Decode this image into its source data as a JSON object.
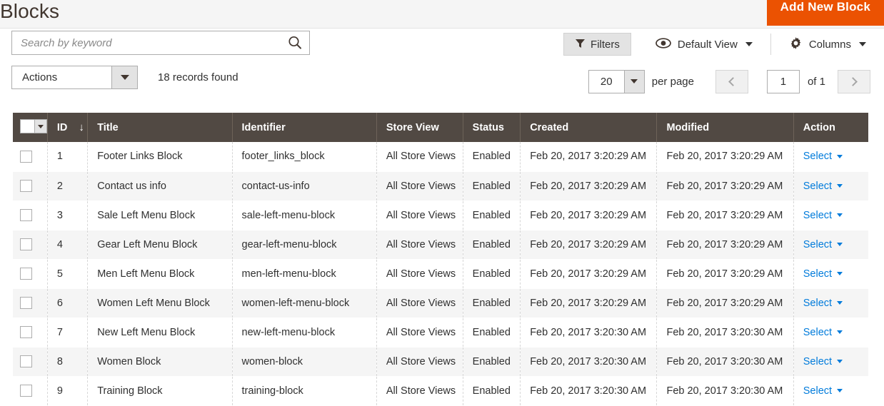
{
  "header": {
    "title": "Blocks",
    "add_button_label": "Add New Block",
    "accent_color": "#eb5202"
  },
  "search": {
    "placeholder": "Search by keyword",
    "value": "",
    "icon": "search-icon"
  },
  "toolbar": {
    "filters_label": "Filters",
    "view_label": "Default View",
    "columns_label": "Columns",
    "eye_icon": "eye-icon",
    "gear_icon": "gear-icon",
    "funnel_icon": "funnel-icon"
  },
  "actions": {
    "label": "Actions",
    "records_found": "18 records found"
  },
  "pagination": {
    "per_page_value": "20",
    "per_page_label": "per page",
    "current_page": "1",
    "of_label": "of 1",
    "prev_icon": "chevron-left-icon",
    "next_icon": "chevron-right-icon"
  },
  "grid": {
    "columns": [
      "ID",
      "Title",
      "Identifier",
      "Store View",
      "Status",
      "Created",
      "Modified",
      "Action"
    ],
    "sort_column": "ID",
    "sort_direction": "desc",
    "sort_glyph": "↓",
    "action_label": "Select",
    "rows": [
      {
        "id": "1",
        "title": "Footer Links Block",
        "identifier": "footer_links_block",
        "store_view": "All Store Views",
        "status": "Enabled",
        "created": "Feb 20, 2017 3:20:29 AM",
        "modified": "Feb 20, 2017 3:20:29 AM",
        "action": "Select"
      },
      {
        "id": "2",
        "title": "Contact us info",
        "identifier": "contact-us-info",
        "store_view": "All Store Views",
        "status": "Enabled",
        "created": "Feb 20, 2017 3:20:29 AM",
        "modified": "Feb 20, 2017 3:20:29 AM",
        "action": "Select"
      },
      {
        "id": "3",
        "title": "Sale Left Menu Block",
        "identifier": "sale-left-menu-block",
        "store_view": "All Store Views",
        "status": "Enabled",
        "created": "Feb 20, 2017 3:20:29 AM",
        "modified": "Feb 20, 2017 3:20:29 AM",
        "action": "Select"
      },
      {
        "id": "4",
        "title": "Gear Left Menu Block",
        "identifier": "gear-left-menu-block",
        "store_view": "All Store Views",
        "status": "Enabled",
        "created": "Feb 20, 2017 3:20:29 AM",
        "modified": "Feb 20, 2017 3:20:29 AM",
        "action": "Select"
      },
      {
        "id": "5",
        "title": "Men Left Menu Block",
        "identifier": "men-left-menu-block",
        "store_view": "All Store Views",
        "status": "Enabled",
        "created": "Feb 20, 2017 3:20:29 AM",
        "modified": "Feb 20, 2017 3:20:29 AM",
        "action": "Select"
      },
      {
        "id": "6",
        "title": "Women Left Menu Block",
        "identifier": "women-left-menu-block",
        "store_view": "All Store Views",
        "status": "Enabled",
        "created": "Feb 20, 2017 3:20:29 AM",
        "modified": "Feb 20, 2017 3:20:29 AM",
        "action": "Select"
      },
      {
        "id": "7",
        "title": "New Left Menu Block",
        "identifier": "new-left-menu-block",
        "store_view": "All Store Views",
        "status": "Enabled",
        "created": "Feb 20, 2017 3:20:30 AM",
        "modified": "Feb 20, 2017 3:20:30 AM",
        "action": "Select"
      },
      {
        "id": "8",
        "title": "Women Block",
        "identifier": "women-block",
        "store_view": "All Store Views",
        "status": "Enabled",
        "created": "Feb 20, 2017 3:20:30 AM",
        "modified": "Feb 20, 2017 3:20:30 AM",
        "action": "Select"
      },
      {
        "id": "9",
        "title": "Training Block",
        "identifier": "training-block",
        "store_view": "All Store Views",
        "status": "Enabled",
        "created": "Feb 20, 2017 3:20:30 AM",
        "modified": "Feb 20, 2017 3:20:30 AM",
        "action": "Select"
      }
    ]
  }
}
